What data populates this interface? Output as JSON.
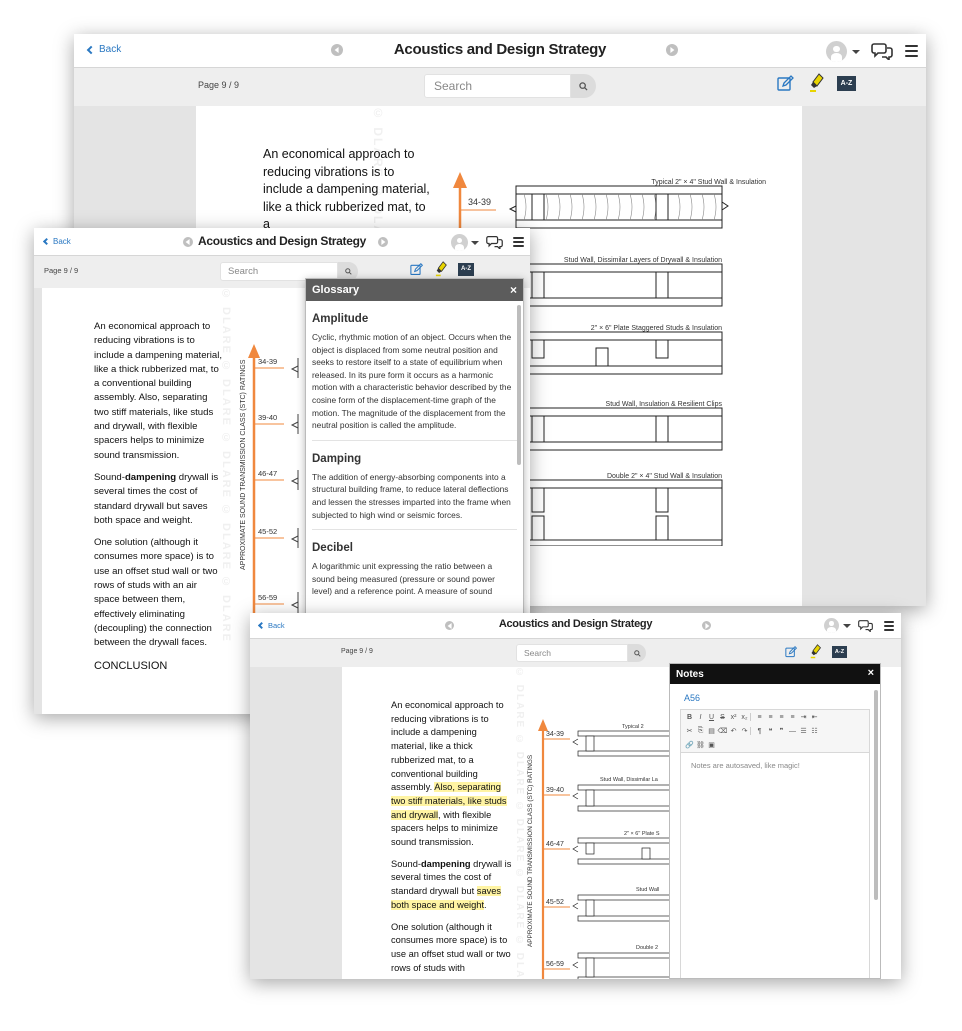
{
  "app": {
    "back_label": "Back",
    "title": "Acoustics and Design Strategy",
    "page_label": "Page 9 / 9",
    "search_placeholder": "Search",
    "edit_icon": "edit-note-icon",
    "highlighter_icon": "highlighter-icon",
    "glossary_icon": "glossary-az-icon",
    "glossary_icon_label": "A-Z"
  },
  "content": {
    "p1": "An economical approach to reducing vibrations is to include a dampening material, like a thick rubberized mat, to a conventional building assembly. Also, separating two stiff materials, like studs and drywall, with flexible spacers helps to minimize sound transmission.",
    "p1_truncated": "An economical approach to reducing vibrations is to include a dampening material, like a thick rubberized mat, to a",
    "p1_a": "An economical approach to reducing vibrations is to include a dampening material, like a thick rubberized mat, to a conventional building assembly. ",
    "p1_hl": "Also, separating two stiff materials, like studs and drywall",
    "p1_b": ", with flexible spacers helps to minimize sound transmission.",
    "p2_a": "Sound-",
    "p2_bold": "dampening",
    "p2_b": " drywall is several times the cost of standard drywall but saves both space and weight.",
    "p2_c": " drywall is several times the cost of standard drywall but ",
    "p2_hl": "saves both space and weight",
    "p2_end": ".",
    "p3": "One solution (although it consumes more space) is to use an offset stud wall or two rows of studs with an air space between them, effectively eliminating (decoupling) the connection between the drywall faces.",
    "p3_truncated": "One solution (although it consumes more space) is to use an offset stud wall or two rows of studs with",
    "heading": "CONCLUSION",
    "watermark": "© DLARE © DLARE © DLARE © DLARE © DLARE"
  },
  "chart": {
    "axis_label": "APPROXIMATE SOUND TRANSMISSION CLASS (STC) RATINGS",
    "arrow_color": "#f0883e",
    "ratings": [
      "34-39",
      "39-40",
      "46-47",
      "45-52",
      "56-59"
    ],
    "assemblies": [
      "Typical 2\" × 4\" Stud Wall & Insulation",
      "Stud Wall, Dissimilar Layers of Drywall & Insulation",
      "2\" × 6\" Plate Staggered Studs & Insulation",
      "Stud Wall, Insulation & Resilient Clips",
      "Double 2\" × 4\" Stud Wall & Insulation"
    ],
    "assemblies_cropped": [
      "Typical 2",
      "Stud Wall, Dissimilar La",
      "2\" × 6\" Plate S",
      "Stud Wall",
      "Double 2"
    ]
  },
  "glossary": {
    "title": "Glossary",
    "close": "×",
    "entries": [
      {
        "term": "Amplitude",
        "definition": "Cyclic, rhythmic motion of an object. Occurs when the object is displaced from some neutral position and seeks to restore itself to a state of equilibrium when released. In its pure form it occurs as a harmonic motion with a characteristic behavior described by the cosine form of the displacement-time graph of the motion. The magnitude of the displacement from the neutral position is called the amplitude."
      },
      {
        "term": "Damping",
        "definition": "The addition of energy-absorbing components into a structural building frame, to reduce lateral deflections and lessen the stresses imparted into the frame when subjected to high wind or seismic forces."
      },
      {
        "term": "Decibel",
        "definition": "A logarithmic unit expressing the ratio between a sound being measured (pressure or sound power level) and a reference point. A measure of sound"
      }
    ]
  },
  "notes": {
    "title": "Notes",
    "close": "×",
    "note_title": "A56",
    "placeholder": "Notes are autosaved, like magic!",
    "toolbar_row1": [
      "B",
      "I",
      "U",
      "S",
      "x²",
      "x₂",
      "|",
      "≡",
      "≡",
      "≡",
      "≡",
      "⇥",
      "⇤"
    ],
    "toolbar_row2": [
      "✂",
      "⎘",
      "▤",
      "⌫",
      "↶",
      "↷",
      "|",
      "¶",
      "❝",
      "❞",
      "—",
      "☰",
      "☷"
    ],
    "toolbar_row3": [
      "🔗",
      "⛓",
      "▣"
    ]
  },
  "colors": {
    "accent_blue": "#2a78c2",
    "highlight": "#fff4a3",
    "glossary_header": "#5c5c5c",
    "notes_header": "#111111",
    "highlighter_yellow": "#e8d400"
  }
}
